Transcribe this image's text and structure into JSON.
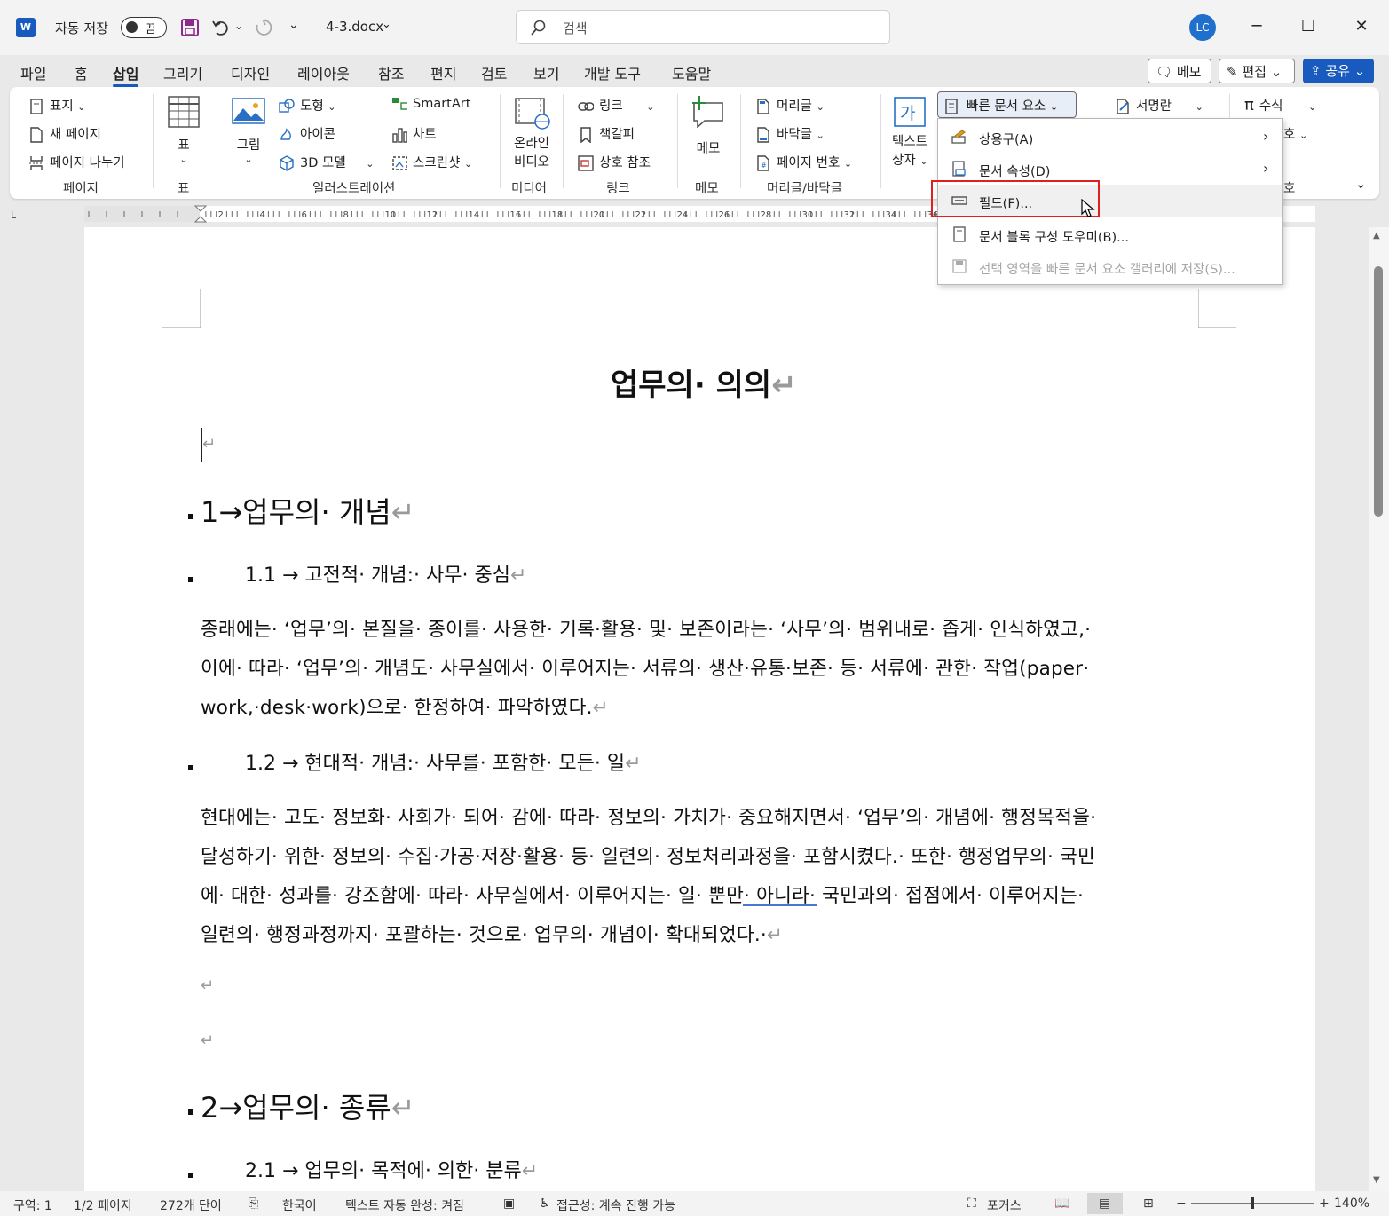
{
  "titlebar": {
    "autosave_label": "자동 저장",
    "autosave_state": "끔",
    "filename": "4-3.docx",
    "search_placeholder": "검색",
    "user_initials": "LC"
  },
  "tabs": [
    "파일",
    "홈",
    "삽입",
    "그리기",
    "디자인",
    "레이아웃",
    "참조",
    "편지",
    "검토",
    "보기",
    "개발 도구",
    "도움말"
  ],
  "active_tab": "삽입",
  "top_right": {
    "memo": "메모",
    "edit": "편집",
    "share": "공유"
  },
  "ribbon": {
    "pages": {
      "cover": "표지",
      "blank": "새 페이지",
      "break": "페이지 나누기",
      "group": "페이지"
    },
    "table": {
      "label": "표",
      "group": "표"
    },
    "illustrations": {
      "picture": "그림",
      "shapes": "도형",
      "icons": "아이콘",
      "model3d": "3D 모델",
      "smartart": "SmartArt",
      "chart": "차트",
      "screenshot": "스크린샷",
      "group": "일러스트레이션"
    },
    "media": {
      "online_video_1": "온라인",
      "online_video_2": "비디오",
      "group": "미디어"
    },
    "links": {
      "link": "링크",
      "bookmark": "책갈피",
      "crossref": "상호 참조",
      "group": "링크"
    },
    "comments": {
      "memo": "메모",
      "group": "메모"
    },
    "headerfooter": {
      "header": "머리글",
      "footer": "바닥글",
      "pagenum": "페이지 번호",
      "group": "머리글/바닥글"
    },
    "text": {
      "textbox_1": "텍스트",
      "textbox_2": "상자",
      "quickparts": "빠른 문서 요소",
      "signature": "서명란"
    },
    "symbols": {
      "equation": "수식",
      "symbol_partial": "호",
      "group_partial": "호"
    }
  },
  "dropdown": {
    "items": [
      {
        "label": "상용구(A)",
        "icon": "autotext-icon",
        "submenu": true,
        "enabled": true
      },
      {
        "label": "문서 속성(D)",
        "icon": "document-property-icon",
        "submenu": true,
        "enabled": true
      },
      {
        "label": "필드(F)...",
        "icon": "field-icon",
        "submenu": false,
        "enabled": true
      },
      {
        "label": "문서 블록 구성 도우미(B)...",
        "icon": "building-blocks-icon",
        "submenu": false,
        "enabled": true
      },
      {
        "label": "선택 영역을 빠른 문서 요소 갤러리에 저장(S)...",
        "icon": "save-selection-icon",
        "submenu": false,
        "enabled": false
      }
    ]
  },
  "document": {
    "title": "업무의· 의의",
    "h1_1": "1→업무의· 개념",
    "h2_1": "1.1 → 고전적· 개념:· 사무· 중심",
    "p1": [
      "종래에는· ‘업무’의· 본질을· 종이를· 사용한· 기록·활용· 및· 보존이라는· ‘사무’의· 범위내로· 좁게· 인식하였고,·",
      "이에· 따라· ‘업무’의· 개념도· 사무실에서· 이루어지는· 서류의· 생산·유통·보존· 등· 서류에· 관한· 작업(paper·",
      "work,·desk·work)으로· 한정하여· 파악하였다."
    ],
    "h2_2": "1.2 → 현대적· 개념:· 사무를· 포함한· 모든· 일",
    "p2": [
      "현대에는· 고도· 정보화· 사회가· 되어· 감에· 따라· 정보의· 가치가· 중요해지면서· ‘업무’의· 개념에· 행정목적을·",
      "달성하기· 위한· 정보의· 수집·가공·저장·활용· 등· 일련의· 정보처리과정을· 포함시켰다.· 또한· 행정업무의· 국민",
      "에· 대한· 성과를· 강조함에· 따라· 사무실에서· 이루어지는· 일· 뿐만· 아니라· 국민과의· 접점에서· 이루어지는·",
      "일련의· 행정과정까지· 포괄하는· 것으로· 업무의· 개념이· 확대되었다.·"
    ],
    "h1_2": "2→업무의· 종류",
    "h2_3": "2.1 → 업무의· 목적에· 의한· 분류",
    "para_mark": "↵"
  },
  "statusbar": {
    "section": "구역: 1",
    "page": "1/2 페이지",
    "words": "272개 단어",
    "language": "한국어",
    "autocomplete": "텍스트 자동 완성: 켜짐",
    "accessibility": "접근성: 계속 진행 가능",
    "focus": "포커스",
    "zoom": "140%"
  }
}
